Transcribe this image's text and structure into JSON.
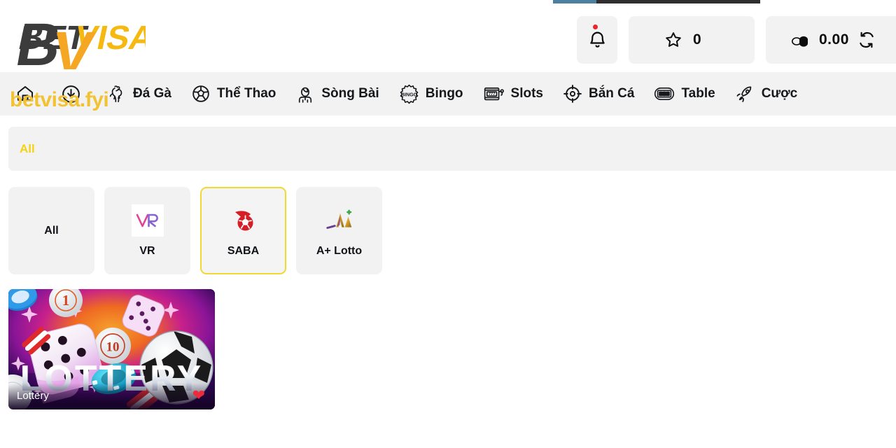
{
  "progress": {
    "name": "page-loading-bar",
    "percent": 21
  },
  "brand": {
    "logo_text_dark": "BET",
    "logo_text_gold": "VISA",
    "watermark_mark": "BV",
    "watermark_url": "betvisa.fyi",
    "colors": {
      "gold": "#F5B912",
      "dark": "#3C3C3C",
      "accent_yellow": "#F5D312"
    }
  },
  "header": {
    "notifications": {
      "icon": "bell-icon",
      "has_unread": true,
      "badge_color": "#E8262B"
    },
    "favorites": {
      "icon": "star-icon",
      "count": "0"
    },
    "balance": {
      "icon": "coins-icon",
      "amount": "0.00",
      "refresh_icon": "refresh-icon"
    }
  },
  "nav": {
    "items": [
      {
        "icon": "home-icon",
        "label": ""
      },
      {
        "icon": "download-icon",
        "label": ""
      },
      {
        "icon": "rooster-icon",
        "label": "Đá Gà"
      },
      {
        "icon": "soccer-ball-icon",
        "label": "Thể Thao"
      },
      {
        "icon": "casino-dealer-icon",
        "label": "Sòng Bài"
      },
      {
        "icon": "bingo-icon",
        "label": "Bingo"
      },
      {
        "icon": "slot-machine-icon",
        "label": "Slots"
      },
      {
        "icon": "target-icon",
        "label": "Bắn Cá"
      },
      {
        "icon": "table-game-icon",
        "label": "Table"
      },
      {
        "icon": "rocket-icon",
        "label": "Cược"
      }
    ]
  },
  "filter_bar": {
    "active_tab": "All"
  },
  "providers": [
    {
      "label": "All",
      "logo": "none",
      "selected": false
    },
    {
      "label": "VR",
      "logo": "vr-logo",
      "selected": false
    },
    {
      "label": "SABA",
      "logo": "saba-logo",
      "selected": true
    },
    {
      "label": "A+ Lotto",
      "logo": "aplus-lotto-logo",
      "selected": false
    }
  ],
  "games": [
    {
      "name": "Lottery",
      "title_art": "LOTTERY",
      "favorite": true,
      "favorite_icon": "heart-icon"
    }
  ]
}
